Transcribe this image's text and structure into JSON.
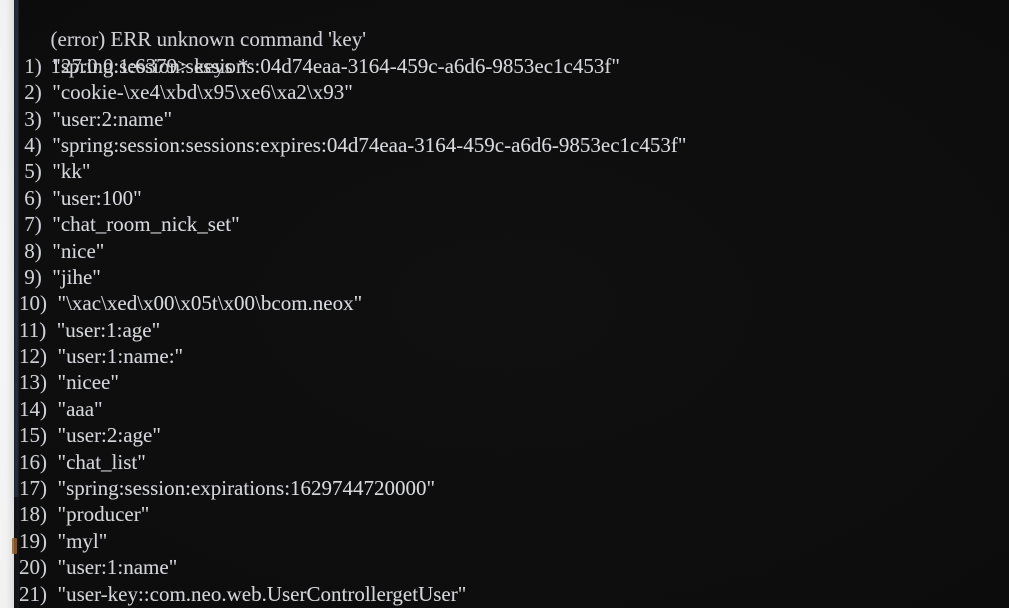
{
  "terminal": {
    "app": "redis-cli",
    "background_color": "#0d0d0d",
    "text_color": "#d8d8dc",
    "margin_color": "#ffffff",
    "window_edge_color": "#2b3040",
    "marker_color": "#9a6530",
    "error_line": "(error) ERR unknown command 'key'",
    "prompt": "127.0.0.1:6379>",
    "command": "keys *",
    "prompt_line": "127.0.0.1:6379> keys *",
    "results": [
      {
        "index": " 1)",
        "value": "\"spring:session:sessions:04d74eaa-3164-459c-a6d6-9853ec1c453f\""
      },
      {
        "index": " 2)",
        "value": "\"cookie-\\xe4\\xbd\\x95\\xe6\\xa2\\x93\""
      },
      {
        "index": " 3)",
        "value": "\"user:2:name\""
      },
      {
        "index": " 4)",
        "value": "\"spring:session:sessions:expires:04d74eaa-3164-459c-a6d6-9853ec1c453f\""
      },
      {
        "index": " 5)",
        "value": "\"kk\""
      },
      {
        "index": " 6)",
        "value": "\"user:100\""
      },
      {
        "index": " 7)",
        "value": "\"chat_room_nick_set\""
      },
      {
        "index": " 8)",
        "value": "\"nice\""
      },
      {
        "index": " 9)",
        "value": "\"jihe\""
      },
      {
        "index": "10)",
        "value": "\"\\xac\\xed\\x00\\x05t\\x00\\bcom.neox\""
      },
      {
        "index": "11)",
        "value": "\"user:1:age\""
      },
      {
        "index": "12)",
        "value": "\"user:1:name:\""
      },
      {
        "index": "13)",
        "value": "\"nicee\""
      },
      {
        "index": "14)",
        "value": "\"aaa\""
      },
      {
        "index": "15)",
        "value": "\"user:2:age\""
      },
      {
        "index": "16)",
        "value": "\"chat_list\""
      },
      {
        "index": "17)",
        "value": "\"spring:session:expirations:1629744720000\""
      },
      {
        "index": "18)",
        "value": "\"producer\""
      },
      {
        "index": "19)",
        "value": "\"myl\""
      },
      {
        "index": "20)",
        "value": "\"user:1:name\""
      },
      {
        "index": "21)",
        "value": "\"user-key::com.neo.web.UserControllergetUser\""
      }
    ]
  }
}
